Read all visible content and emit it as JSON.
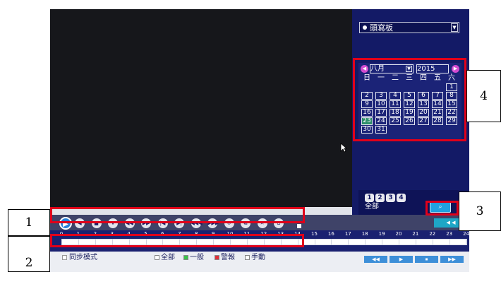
{
  "camera_dropdown": {
    "value": "頭寫板"
  },
  "calendar": {
    "month": "八月",
    "year": "2015",
    "weekdays": [
      "日",
      "一",
      "二",
      "三",
      "四",
      "五",
      "六"
    ],
    "days": [
      "1",
      "2",
      "3",
      "4",
      "5",
      "6",
      "7",
      "8",
      "9",
      "10",
      "11",
      "12",
      "13",
      "14",
      "15",
      "16",
      "17",
      "18",
      "19",
      "20",
      "21",
      "22",
      "23",
      "24",
      "25",
      "26",
      "27",
      "28",
      "29",
      "30",
      "31"
    ],
    "highlighted_day": "23",
    "nav_prev": "◀",
    "nav_next": "▶"
  },
  "channels": {
    "numbers": [
      "1",
      "2",
      "3",
      "4"
    ],
    "all_label": "全部"
  },
  "controls": {
    "play": "▶",
    "buttons": [
      "◀",
      "■",
      "⏸",
      "◀◀",
      "▶▶",
      "|◀",
      "▶|",
      "◀◀◀",
      "▶▶▶",
      "↺",
      "⧉",
      "✕",
      "⌂"
    ],
    "right_button": "◀ ◀"
  },
  "timeline": {
    "hours": [
      "0",
      "1",
      "2",
      "3",
      "4",
      "5",
      "6",
      "7",
      "8",
      "9",
      "10",
      "11",
      "12",
      "13",
      "14",
      "15",
      "16",
      "17",
      "18",
      "19",
      "20",
      "21",
      "22",
      "23",
      "24"
    ]
  },
  "bottom": {
    "sync_mode": "同步模式",
    "legend": [
      {
        "label": "全部",
        "color": "#ffffff"
      },
      {
        "label": "一般",
        "color": "#3cc24a"
      },
      {
        "label": "警報",
        "color": "#e0303a"
      },
      {
        "label": "手動",
        "color": "#ffffff"
      }
    ],
    "right_buttons": [
      "◀◀",
      "▶",
      "⏹",
      "▶▶"
    ]
  },
  "annotations": {
    "labels": [
      "1",
      "2",
      "3",
      "4"
    ]
  },
  "search_icon": "⌕",
  "colors": {
    "highlight": "#e0001a",
    "panel": "#131a66",
    "accent": "#21a2e0"
  }
}
